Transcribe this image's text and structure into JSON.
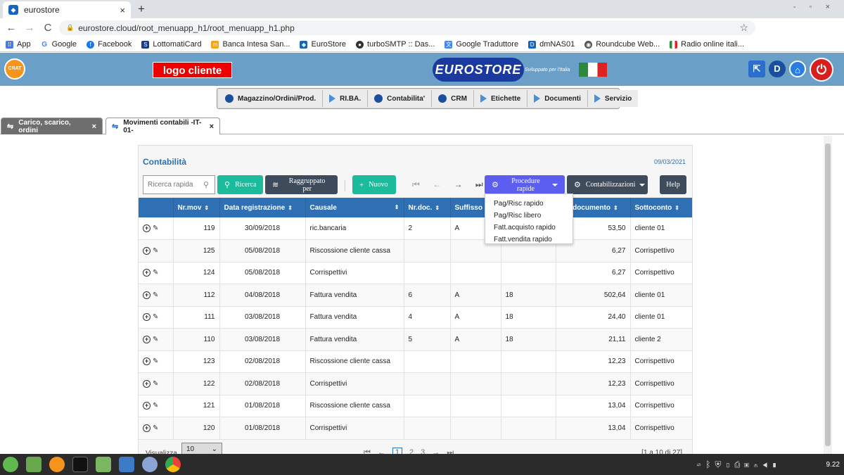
{
  "browser": {
    "tab_title": "eurostore",
    "tab_close": "×",
    "new_tab": "+",
    "window_controls": "- ◦ ×",
    "back": "←",
    "forward": "→",
    "reload": "C",
    "url": "eurostore.cloud/root_menuapp_h1/root_menuapp_h1.php",
    "profile": "E",
    "bookmarks": [
      "App",
      "Google",
      "Facebook",
      "LottomatiCard",
      "Banca Intesa San...",
      "EuroStore",
      "turboSMTP :: Das...",
      "Google Traduttore",
      "dmNAS01",
      "Roundcube Web...",
      "Radio online itali..."
    ]
  },
  "banner": {
    "app_logo": "CRAT",
    "client_logo": "logo cliente",
    "brand": "EUROSTORE",
    "tagline": "Sviluppato per l'Italia",
    "power": "⏻"
  },
  "menu": {
    "items": [
      "Magazzino/Ordini/Prod.",
      "RI.BA.",
      "Contabilita'",
      "CRM",
      "Etichette",
      "Documenti",
      "Servizio"
    ]
  },
  "app_tabs": [
    {
      "label": "Carico, scarico, ordini",
      "close": "×"
    },
    {
      "label": "Movimenti contabili -IT-01-",
      "close": "×"
    }
  ],
  "panel": {
    "title": "Contabilità",
    "date": "09/03/2021",
    "search_placeholder": "Ricerca rapida",
    "btn_ricerca": "Ricerca",
    "btn_raggruppato": "Raggruppato per",
    "btn_nuovo": "Nuovo",
    "btn_procedure": "Procedure rapide",
    "btn_contab": "Contabilizzazioni",
    "btn_help": "Help",
    "procedure_options": [
      "Pag/Risc rapido",
      "Pag/Risc libero",
      "Fatt.acquisto rapido",
      "Fatt.vendita rapido"
    ],
    "columns": [
      "",
      "Nr.mov",
      "Data registrazione",
      "Causale",
      "Nr.doc.",
      "Suffisso",
      "",
      "Tot.documento",
      "Sottoconto"
    ],
    "rows": [
      [
        "119",
        "30/09/2018",
        "ric.bancaria",
        "2",
        "A",
        "",
        "53,50",
        "cliente 01"
      ],
      [
        "125",
        "05/08/2018",
        "Riscossione cliente cassa",
        "",
        "",
        "",
        "6,27",
        "Corrispettivo"
      ],
      [
        "124",
        "05/08/2018",
        "Corrispettivi",
        "",
        "",
        "",
        "6,27",
        "Corrispettivo"
      ],
      [
        "112",
        "04/08/2018",
        "Fattura vendita",
        "6",
        "A",
        "18",
        "502,64",
        "cliente 01"
      ],
      [
        "111",
        "03/08/2018",
        "Fattura vendita",
        "4",
        "A",
        "18",
        "24,40",
        "cliente 01"
      ],
      [
        "110",
        "03/08/2018",
        "Fattura vendita",
        "5",
        "A",
        "18",
        "21,11",
        "cliente 2"
      ],
      [
        "123",
        "02/08/2018",
        "Riscossione cliente cassa",
        "",
        "",
        "",
        "12,23",
        "Corrispettivo"
      ],
      [
        "122",
        "02/08/2018",
        "Corrispettivi",
        "",
        "",
        "",
        "12,23",
        "Corrispettivo"
      ],
      [
        "121",
        "01/08/2018",
        "Riscossione cliente cassa",
        "",
        "",
        "",
        "13,04",
        "Corrispettivo"
      ],
      [
        "120",
        "01/08/2018",
        "Corrispettivi",
        "",
        "",
        "",
        "13,04",
        "Corrispettivo"
      ]
    ],
    "footer": {
      "visualizza": "Visualizza",
      "page_size": "10",
      "pages": [
        "1",
        "2",
        "3"
      ],
      "info": "[1 a 10 di 27]"
    }
  },
  "taskbar": {
    "clock": "9.22"
  }
}
